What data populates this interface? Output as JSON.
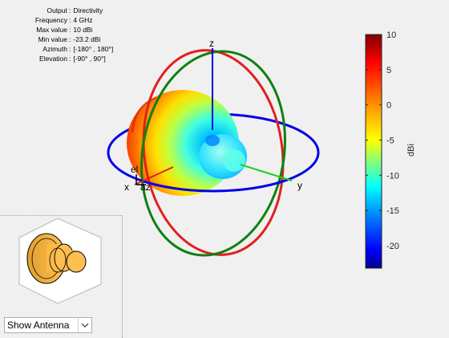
{
  "info": {
    "rows": [
      {
        "key": "Output",
        "value": "Directivity"
      },
      {
        "key": "Frequency",
        "value": "4 GHz"
      },
      {
        "key": "Max value",
        "value": "10 dBi"
      },
      {
        "key": "Min value",
        "value": "-23.2 dBi"
      },
      {
        "key": "Azimuth",
        "value": "[-180° , 180°]"
      },
      {
        "key": "Elevation",
        "value": "[-90° , 90°]"
      }
    ],
    "separator": ":"
  },
  "axes": {
    "z": "z",
    "x": "x",
    "y": "y",
    "el": "el",
    "az": "az"
  },
  "colorbar": {
    "label": "dBi",
    "ticks": [
      "10",
      "5",
      "0",
      "-5",
      "-10",
      "-15",
      "-20"
    ],
    "tick_values": [
      10,
      5,
      0,
      -5,
      -10,
      -15,
      -20
    ],
    "min": -23.2,
    "max": 10,
    "colormap": [
      "#7f0000",
      "#ff0000",
      "#ff8000",
      "#ffff00",
      "#80ff80",
      "#00ffff",
      "#0080ff",
      "#0000ff",
      "#00008f"
    ]
  },
  "colors": {
    "azimuth_circle": "#0000e6",
    "elevation_circle_xz": "#e02020",
    "elevation_circle_yz": "#108010",
    "x_axis": "#e02020",
    "y_axis": "#20d020",
    "z_axis": "#0000e6"
  },
  "dropdown": {
    "selected": "Show Antenna"
  }
}
